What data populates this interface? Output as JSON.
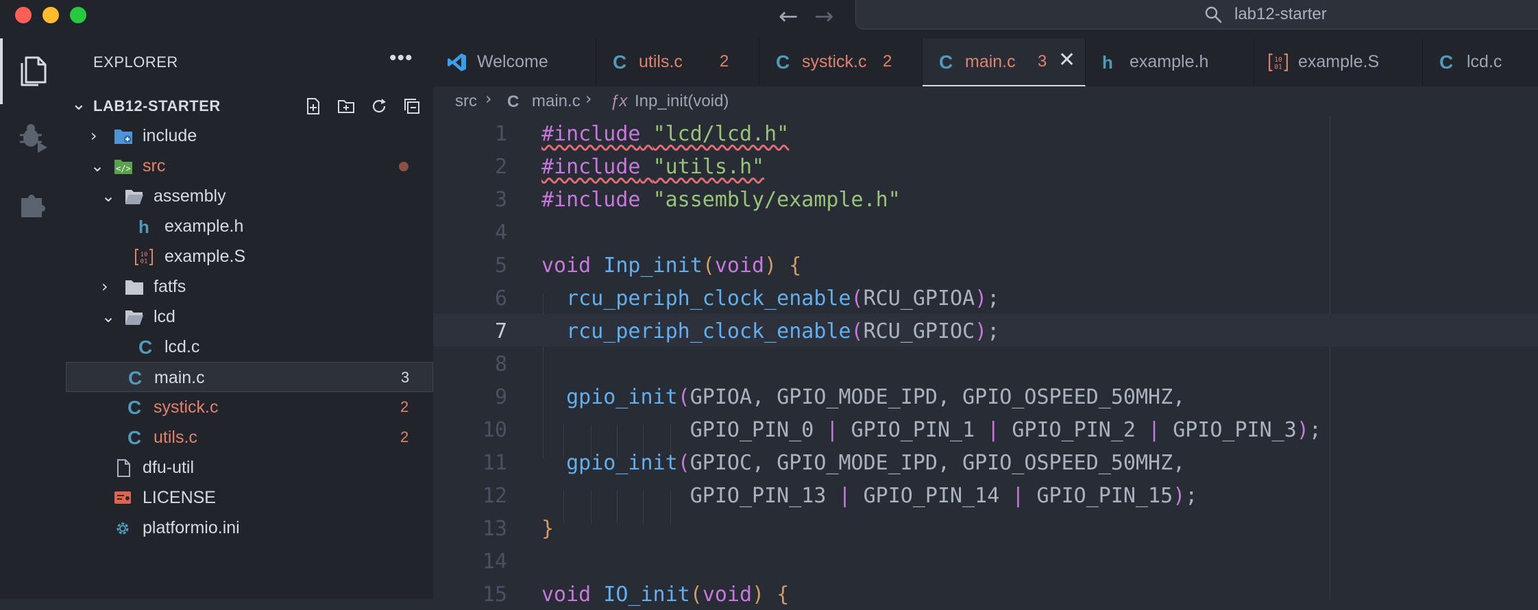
{
  "titlebar": {
    "search_text": "lab12-starter",
    "back_glyph": "←",
    "forward_glyph": "→"
  },
  "activity_bar": [
    "explorer-icon",
    "run-debug-icon",
    "extensions-icon"
  ],
  "explorer": {
    "title": "EXPLORER",
    "more": "•••",
    "root": "LAB12-STARTER",
    "tree": [
      {
        "label": "include",
        "kind": "folder",
        "depth": 0,
        "chevron": "›"
      },
      {
        "label": "src",
        "kind": "folder",
        "depth": 0,
        "chevron": "⌄"
      },
      {
        "label": "assembly",
        "kind": "folder",
        "depth": 1,
        "chevron": "⌄"
      },
      {
        "label": "example.h",
        "kind": "h",
        "depth": 2
      },
      {
        "label": "example.S",
        "kind": "asm",
        "depth": 2
      },
      {
        "label": "fatfs",
        "kind": "folder",
        "depth": 1,
        "chevron": "›"
      },
      {
        "label": "lcd",
        "kind": "folder",
        "depth": 1,
        "chevron": "⌄"
      },
      {
        "label": "lcd.c",
        "kind": "c",
        "depth": 2
      },
      {
        "label": "main.c",
        "kind": "c",
        "depth": 1,
        "badge": "3"
      },
      {
        "label": "systick.c",
        "kind": "c",
        "depth": 1,
        "badge": "2"
      },
      {
        "label": "utils.c",
        "kind": "c",
        "depth": 1,
        "badge": "2"
      },
      {
        "label": "dfu-util",
        "kind": "file",
        "depth": 0
      },
      {
        "label": "LICENSE",
        "kind": "license",
        "depth": 0
      },
      {
        "label": "platformio.ini",
        "kind": "gear",
        "depth": 0
      }
    ]
  },
  "tabs": [
    {
      "label": "Welcome",
      "icon": "vscode-icon"
    },
    {
      "label": "utils.c",
      "icon": "c-file-icon",
      "badge": "2"
    },
    {
      "label": "systick.c",
      "icon": "c-file-icon",
      "badge": "2"
    },
    {
      "label": "main.c",
      "icon": "c-file-icon",
      "badge": "3",
      "close": "✕"
    },
    {
      "label": "example.h",
      "icon": "h-file-icon"
    },
    {
      "label": "example.S",
      "icon": "asm-file-icon"
    },
    {
      "label": "lcd.c",
      "icon": "c-file-icon"
    }
  ],
  "breadcrumb": {
    "folder": "src",
    "file": "main.c",
    "symbol": "Inp_init(void)",
    "sep": "›"
  },
  "editor": {
    "line_numbers": [
      "1",
      "2",
      "3",
      "4",
      "5",
      "6",
      "7",
      "8",
      "9",
      "10",
      "11",
      "12",
      "13",
      "14",
      "15"
    ],
    "current_line": "7",
    "tokens": {
      "include_kw": "#include",
      "inc1": "\"lcd/lcd.h\"",
      "inc2": "\"utils.h\"",
      "inc3": "\"assembly/example.h\"",
      "void": "void",
      "fn_inp": "Inp_init",
      "fn_io": "IO_init",
      "lparen": "(",
      "rparen": ")",
      "lbrace": "{",
      "rbrace": "}",
      "rcu_fn": "rcu_periph_clock_enable",
      "rcu_a": "RCU_GPIOA",
      "rcu_c": "RCU_GPIOC",
      "semi": ";",
      "comma_sp": ", ",
      "comma": ",",
      "gpio_fn": "gpio_init",
      "gpioa": "GPIOA",
      "gpioc": "GPIOC",
      "mode": "GPIO_MODE_IPD",
      "speed": "GPIO_OSPEED_50MHZ",
      "pipe": " | ",
      "pin0": "GPIO_PIN_0",
      "pin1": "GPIO_PIN_1",
      "pin2": "GPIO_PIN_2",
      "pin3": "GPIO_PIN_3",
      "pin13": "GPIO_PIN_13",
      "pin14": "GPIO_PIN_14",
      "pin15": "GPIO_PIN_15"
    }
  },
  "colors": {
    "modified": "#e0826d",
    "keyword": "#c678dd",
    "function": "#61afef",
    "string": "#98c379",
    "bracket": "#d19a66"
  }
}
